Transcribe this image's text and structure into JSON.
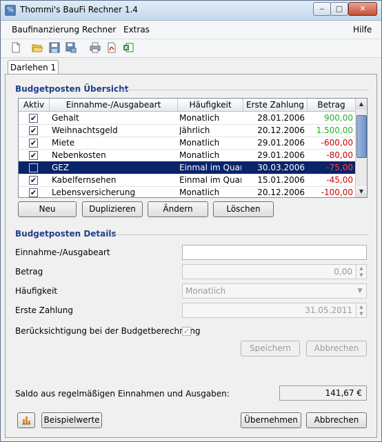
{
  "window": {
    "title": "Thommi's BauFi Rechner 1.4",
    "app_icon": "%",
    "min": "‒",
    "max": "□",
    "close": "✕"
  },
  "menu": {
    "items": [
      "Baufinanzierung",
      "Rechner",
      "Extras"
    ],
    "help": "Hilfe"
  },
  "toolbar": {
    "icons": [
      "new-document-icon",
      "open-folder-icon",
      "save-icon",
      "save-as-icon",
      "print-icon",
      "pdf-export-icon",
      "excel-export-icon"
    ]
  },
  "tabs": [
    {
      "label": "Darlehen 1"
    }
  ],
  "overview": {
    "title": "Budgetposten Übersicht",
    "columns": [
      "Aktiv",
      "Einnahme-/Ausgabeart",
      "Häufigkeit",
      "Erste Zahlung",
      "Betrag"
    ],
    "rows": [
      {
        "active": true,
        "type": "Gehalt",
        "freq": "Monatlich",
        "date": "28.01.2006",
        "amount": "900,00",
        "color": "#22b022"
      },
      {
        "active": true,
        "type": "Weihnachtsgeld",
        "freq": "Jährlich",
        "date": "20.12.2006",
        "amount": "1.500,00",
        "color": "#22b022"
      },
      {
        "active": true,
        "type": "Miete",
        "freq": "Monatlich",
        "date": "29.01.2006",
        "amount": "-600,00",
        "color": "#d10000"
      },
      {
        "active": true,
        "type": "Nebenkosten",
        "freq": "Monatlich",
        "date": "29.01.2006",
        "amount": "-80,00",
        "color": "#d10000"
      },
      {
        "active": false,
        "type": "GEZ",
        "freq": "Einmal im Quar...",
        "date": "30.03.2006",
        "amount": "-75,00",
        "color": "#ff4444"
      },
      {
        "active": true,
        "type": "Kabelfernsehen",
        "freq": "Einmal im Quar...",
        "date": "15.01.2006",
        "amount": "-45,00",
        "color": "#d10000"
      },
      {
        "active": true,
        "type": "Lebensversicherung",
        "freq": "Monatlich",
        "date": "20.12.2006",
        "amount": "-100,00",
        "color": "#d10000"
      }
    ],
    "buttons": {
      "new": "Neu",
      "duplicate": "Duplizieren",
      "change": "Ändern",
      "delete": "Löschen"
    }
  },
  "details": {
    "title": "Budgetposten Details",
    "type_label": "Einnahme-/Ausgabeart",
    "type_value": "",
    "amount_label": "Betrag",
    "amount_value": "0,00",
    "freq_label": "Häufigkeit",
    "freq_value": "Monatlich",
    "date_label": "Erste Zahlung",
    "date_value": "31.05.2011",
    "consider_label": "Berücksichtigung bei der Budgetberechnung",
    "consider_checked": true,
    "save": "Speichern",
    "cancel": "Abbrechen"
  },
  "saldo": {
    "label": "Saldo aus regelmäßigen Einnahmen und Ausgaben:",
    "value": "141,67 €"
  },
  "footer": {
    "chart_icon": "bar-chart-icon",
    "example": "Beispielwerte",
    "accept": "Übernehmen",
    "cancel": "Abbrechen"
  }
}
